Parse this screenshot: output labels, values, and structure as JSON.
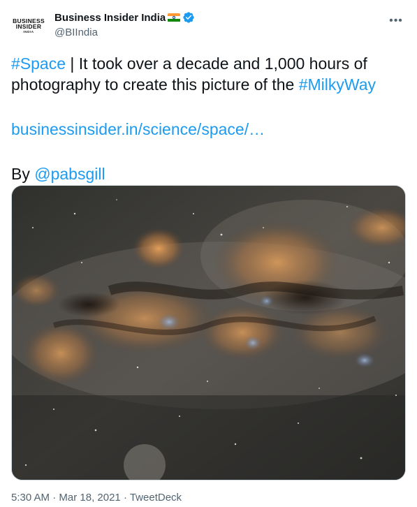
{
  "account": {
    "name": "Business Insider India",
    "handle": "@BIIndia",
    "avatar_lines": [
      "BUSINESS",
      "INSIDER",
      "INDIA"
    ],
    "flag_icon": "india-flag-icon",
    "verified_icon": "verified-badge-icon"
  },
  "more_icon": "more-options-icon",
  "tweet": {
    "hashtag_space": "#Space",
    "text_part1": " | It took over a decade and 1,000 hours of photography to create this picture of the ",
    "hashtag_milkyway": "#MilkyWay",
    "link": "businessinsider.in/science/space/…",
    "by_prefix": "By ",
    "mention": "@pabsgill"
  },
  "media": {
    "alt": "Milky Way composite photograph"
  },
  "footer": {
    "time": "5:30 AM",
    "sep1": " · ",
    "date": "Mar 18, 2021",
    "sep2": " · ",
    "source": "TweetDeck"
  },
  "colors": {
    "link": "#1d9bf0",
    "text": "#0f1419",
    "secondary": "#536471"
  }
}
